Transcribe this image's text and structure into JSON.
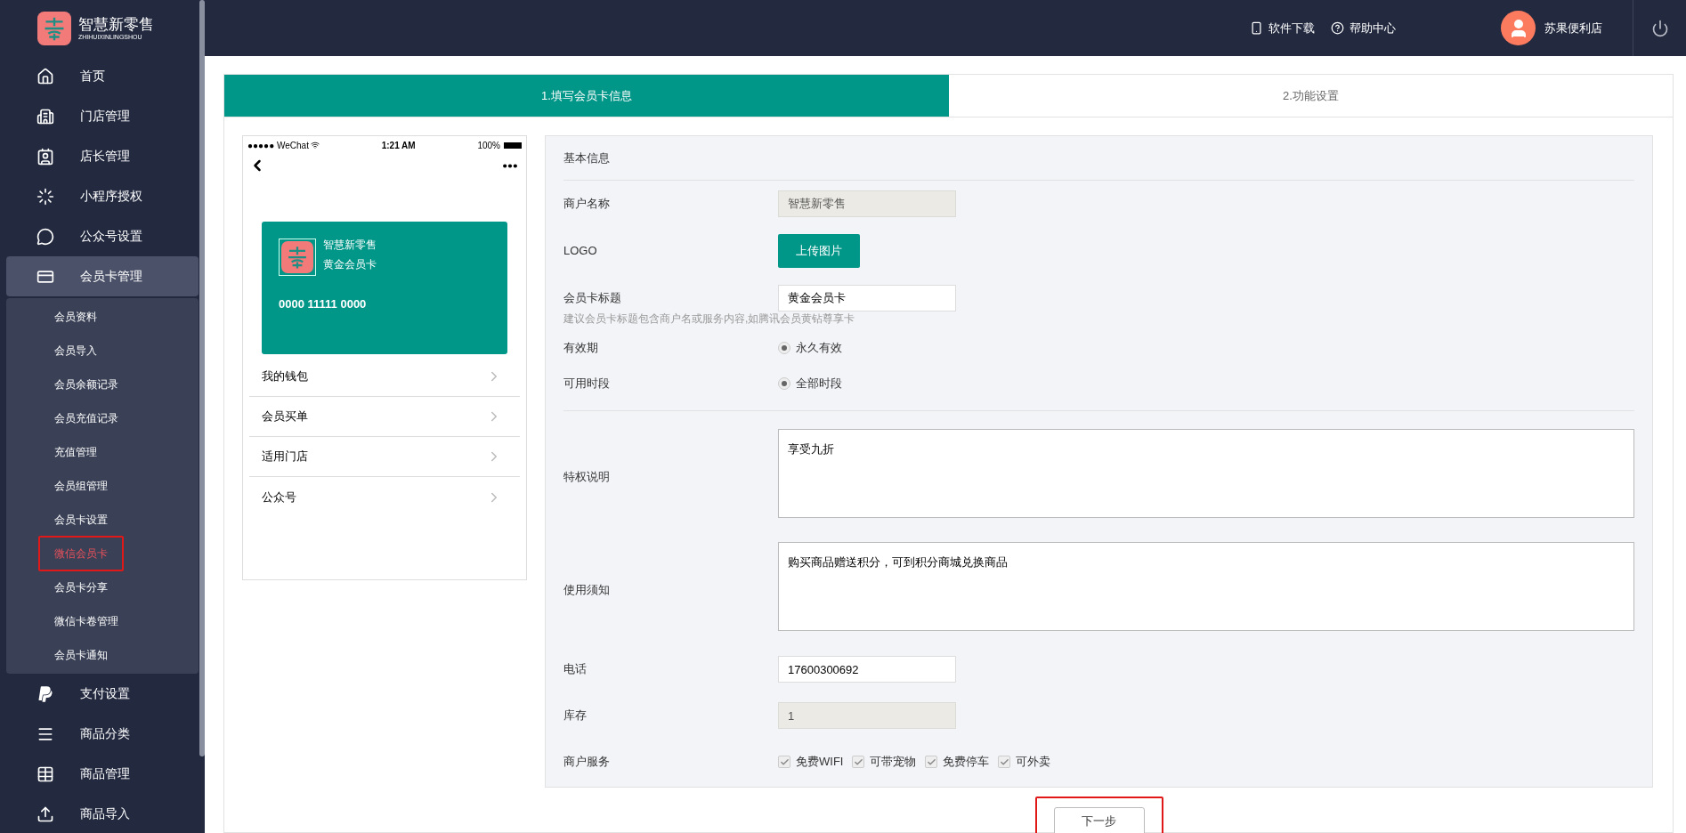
{
  "brand": {
    "name": "智慧新零售",
    "subtitle": "ZHIHUIXINLINGSHOU"
  },
  "sidebar": {
    "items": [
      {
        "label": "首页",
        "expanded": false
      },
      {
        "label": "门店管理",
        "expanded": false
      },
      {
        "label": "店长管理",
        "expanded": false
      },
      {
        "label": "小程序授权",
        "expanded": false
      },
      {
        "label": "公众号设置",
        "expanded": false
      },
      {
        "label": "会员卡管理",
        "expanded": true,
        "children": [
          {
            "label": "会员资料",
            "selected": false,
            "highlighted": false
          },
          {
            "label": "会员导入",
            "selected": false,
            "highlighted": false
          },
          {
            "label": "会员余额记录",
            "selected": false,
            "highlighted": false
          },
          {
            "label": "会员充值记录",
            "selected": false,
            "highlighted": false
          },
          {
            "label": "充值管理",
            "selected": false,
            "highlighted": false
          },
          {
            "label": "会员组管理",
            "selected": false,
            "highlighted": false
          },
          {
            "label": "会员卡设置",
            "selected": false,
            "highlighted": false
          },
          {
            "label": "微信会员卡",
            "selected": true,
            "highlighted": true
          },
          {
            "label": "会员卡分享",
            "selected": false,
            "highlighted": false
          },
          {
            "label": "微信卡卷管理",
            "selected": false,
            "highlighted": false
          },
          {
            "label": "会员卡通知",
            "selected": false,
            "highlighted": false
          }
        ]
      },
      {
        "label": "支付设置",
        "expanded": false
      },
      {
        "label": "商品分类",
        "expanded": false
      },
      {
        "label": "商品管理",
        "expanded": false
      },
      {
        "label": "商品导入",
        "expanded": false
      }
    ]
  },
  "topbar": {
    "links": [
      "软件下载",
      "帮助中心"
    ],
    "user": "苏果便利店"
  },
  "steps": [
    {
      "label": "1.填写会员卡信息",
      "selected": true
    },
    {
      "label": "2.功能设置",
      "selected": false
    }
  ],
  "phone": {
    "carrier": "●●●●● WeChat",
    "time": "1:21 AM",
    "battery": "100%",
    "card": {
      "merchant": "智慧新零售",
      "title": "黄金会员卡",
      "number": "0000 11111 0000"
    },
    "menu": [
      "我的钱包",
      "会员买单",
      "适用门店",
      "公众号"
    ]
  },
  "form": {
    "section_title": "基本信息",
    "fields": [
      {
        "label": "商户名称",
        "kind": "readonly",
        "value": "智慧新零售"
      },
      {
        "label": "LOGO",
        "kind": "upload",
        "button": "上传图片"
      },
      {
        "label": "会员卡标题",
        "kind": "text",
        "value": "黄金会员卡",
        "hint": "建议会员卡标题包含商户名或服务内容,如腾讯会员黄钻尊享卡"
      },
      {
        "label": "有效期",
        "kind": "radio",
        "options": [
          {
            "label": "永久有效",
            "selected": true
          }
        ]
      },
      {
        "label": "可用时段",
        "kind": "radio",
        "options": [
          {
            "label": "全部时段",
            "selected": true
          }
        ]
      },
      {
        "label": "特权说明",
        "kind": "textarea",
        "value": "享受九折",
        "divider_before": true
      },
      {
        "label": "使用须知",
        "kind": "textarea",
        "value": "购买商品赠送积分，可到积分商城兑换商品"
      },
      {
        "label": "电话",
        "kind": "text",
        "value": "17600300692"
      },
      {
        "label": "库存",
        "kind": "readonly",
        "value": "1"
      },
      {
        "label": "商户服务",
        "kind": "checkboxes",
        "options": [
          {
            "label": "免费WIFI",
            "checked": true
          },
          {
            "label": "可带宠物",
            "checked": true
          },
          {
            "label": "免费停车",
            "checked": true
          },
          {
            "label": "可外卖",
            "checked": true
          }
        ]
      }
    ]
  },
  "next_button": {
    "label": "下一步",
    "highlighted": true
  }
}
